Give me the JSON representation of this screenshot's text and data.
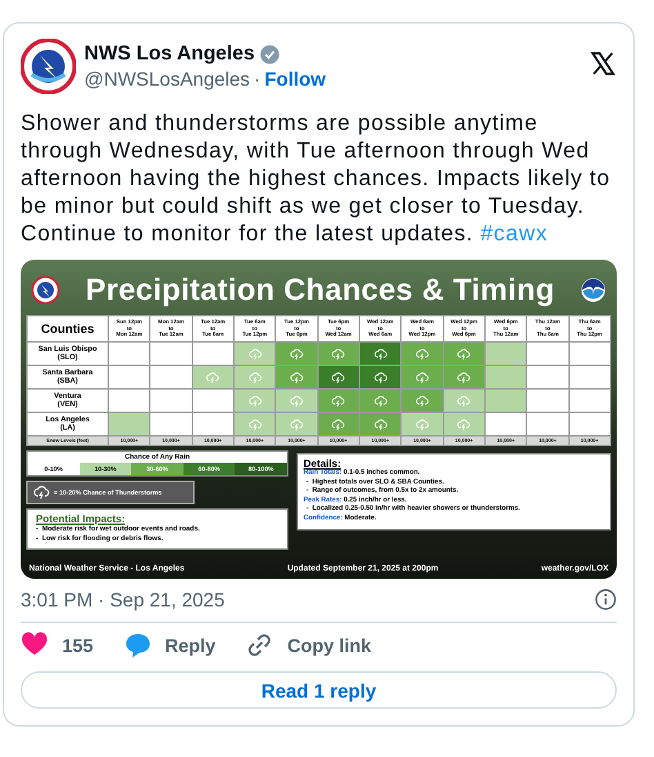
{
  "tweet": {
    "author": {
      "name": "NWS Los Angeles",
      "verified": true,
      "handle": "@NWSLosAngeles",
      "separator": "·",
      "follow": "Follow"
    },
    "text": "Shower and thunderstorms are possible anytime through Wednesday, with Tue afternoon through Wed afternoon having the highest chances. Impacts likely to be minor but could shift as we get closer to Tuesday. Continue to monitor for the latest updates.",
    "hashtag": "#cawx",
    "graphic": {
      "title": "Precipitation Chances & Timing",
      "table": {
        "corner": "Counties",
        "columns": [
          "Sun 12pm\nto\nMon 12am",
          "Mon 12am\nto\nTue 12am",
          "Tue 12am\nto\nTue 6am",
          "Tue 6am\nto\nTue 12pm",
          "Tue 12pm\nto\nTue 6pm",
          "Tue 6pm\nto\nWed 12am",
          "Wed 12am\nto\nWed 6am",
          "Wed 6am\nto\nWed 12pm",
          "Wed 12pm\nto\nWed 6pm",
          "Wed 6pm\nto\nThu 12am",
          "Thu 12am\nto\nThu 6am",
          "Thu 6am\nto\nThu 12pm"
        ],
        "rows": [
          {
            "county": "San Luis Obispo\n(SLO)",
            "cells": [
              {
                "color": "#ffffff",
                "thunder": false
              },
              {
                "color": "#ffffff",
                "thunder": false
              },
              {
                "color": "#ffffff",
                "thunder": false
              },
              {
                "color": "#b3d7a3",
                "thunder": true
              },
              {
                "color": "#6cae4e",
                "thunder": true
              },
              {
                "color": "#6cae4e",
                "thunder": true
              },
              {
                "color": "#3b7f2b",
                "thunder": true
              },
              {
                "color": "#6cae4e",
                "thunder": true
              },
              {
                "color": "#6cae4e",
                "thunder": true
              },
              {
                "color": "#b3d7a3",
                "thunder": false
              },
              {
                "color": "#ffffff",
                "thunder": false
              },
              {
                "color": "#ffffff",
                "thunder": false
              }
            ]
          },
          {
            "county": "Santa Barbara\n(SBA)",
            "cells": [
              {
                "color": "#ffffff",
                "thunder": false
              },
              {
                "color": "#ffffff",
                "thunder": false
              },
              {
                "color": "#b3d7a3",
                "thunder": true
              },
              {
                "color": "#b3d7a3",
                "thunder": true
              },
              {
                "color": "#6cae4e",
                "thunder": true
              },
              {
                "color": "#3b7f2b",
                "thunder": true
              },
              {
                "color": "#3b7f2b",
                "thunder": true
              },
              {
                "color": "#6cae4e",
                "thunder": true
              },
              {
                "color": "#6cae4e",
                "thunder": true
              },
              {
                "color": "#b3d7a3",
                "thunder": false
              },
              {
                "color": "#ffffff",
                "thunder": false
              },
              {
                "color": "#ffffff",
                "thunder": false
              }
            ]
          },
          {
            "county": "Ventura\n(VEN)",
            "cells": [
              {
                "color": "#ffffff",
                "thunder": false
              },
              {
                "color": "#ffffff",
                "thunder": false
              },
              {
                "color": "#ffffff",
                "thunder": false
              },
              {
                "color": "#b3d7a3",
                "thunder": true
              },
              {
                "color": "#b3d7a3",
                "thunder": true
              },
              {
                "color": "#6cae4e",
                "thunder": true
              },
              {
                "color": "#6cae4e",
                "thunder": true
              },
              {
                "color": "#6cae4e",
                "thunder": true
              },
              {
                "color": "#b3d7a3",
                "thunder": true
              },
              {
                "color": "#b3d7a3",
                "thunder": false
              },
              {
                "color": "#ffffff",
                "thunder": false
              },
              {
                "color": "#ffffff",
                "thunder": false
              }
            ]
          },
          {
            "county": "Los Angeles\n(LA)",
            "cells": [
              {
                "color": "#b3d7a3",
                "thunder": false
              },
              {
                "color": "#ffffff",
                "thunder": false
              },
              {
                "color": "#ffffff",
                "thunder": false
              },
              {
                "color": "#b3d7a3",
                "thunder": true
              },
              {
                "color": "#b3d7a3",
                "thunder": true
              },
              {
                "color": "#6cae4e",
                "thunder": true
              },
              {
                "color": "#6cae4e",
                "thunder": true
              },
              {
                "color": "#b3d7a3",
                "thunder": true
              },
              {
                "color": "#b3d7a3",
                "thunder": true
              },
              {
                "color": "#ffffff",
                "thunder": false
              },
              {
                "color": "#ffffff",
                "thunder": false
              },
              {
                "color": "#ffffff",
                "thunder": false
              }
            ]
          }
        ],
        "snow_label": "Snow Levels (feet)",
        "snow_levels": [
          "10,000+",
          "10,000+",
          "10,000+",
          "10,000+",
          "10,000+",
          "10,000+",
          "10,000+",
          "10,000+",
          "10,000+",
          "10,000+",
          "10,000+",
          "10,000+"
        ]
      },
      "legend": {
        "title": "Chance of Any Rain",
        "items": [
          {
            "label": "0-10%",
            "color": "#ffffff"
          },
          {
            "label": "10-30%",
            "color": "#b3d7a3"
          },
          {
            "label": "30-60%",
            "color": "#6cae4e"
          },
          {
            "label": "60-80%",
            "color": "#3b7f2b"
          },
          {
            "label": "80-100%",
            "color": "#2a5e1e"
          }
        ]
      },
      "thunder_legend": "= 10-20% Chance of Thunderstorms",
      "impacts": {
        "title": "Potential Impacts:",
        "bullets": [
          "-  Moderate risk for wet outdoor events and roads.",
          "-  Low risk for flooding or debris flows."
        ]
      },
      "details": {
        "title": "Details:",
        "lines": [
          {
            "kind": "labeled",
            "label": "Rain Totals:",
            "text": "0.1-0.5 inches common."
          },
          {
            "kind": "bullet",
            "text": "-  Highest totals over SLO & SBA Counties."
          },
          {
            "kind": "bullet",
            "text": "-  Range of outcomes, from 0.5x to 2x amounts."
          },
          {
            "kind": "labeled",
            "label": "Peak Rates:",
            "text": "0.25 inch/hr or less."
          },
          {
            "kind": "bullet",
            "text": "-  Localized 0.25-0.50 in/hr with heavier showers or thunderstorms."
          },
          {
            "kind": "labeled",
            "label": "Confidence:",
            "text": "Moderate."
          }
        ]
      },
      "footer": [
        "National Weather Service - Los Angeles",
        "Updated September 21, 2025 at 200pm",
        "weather.gov/LOX"
      ]
    },
    "timestamp": "3:01 PM · Sep 21, 2025",
    "actions": [
      {
        "kind": "like",
        "label": "155"
      },
      {
        "kind": "reply",
        "label": "Reply"
      },
      {
        "kind": "copy",
        "label": "Copy link"
      }
    ],
    "read_button": "Read 1 reply"
  }
}
